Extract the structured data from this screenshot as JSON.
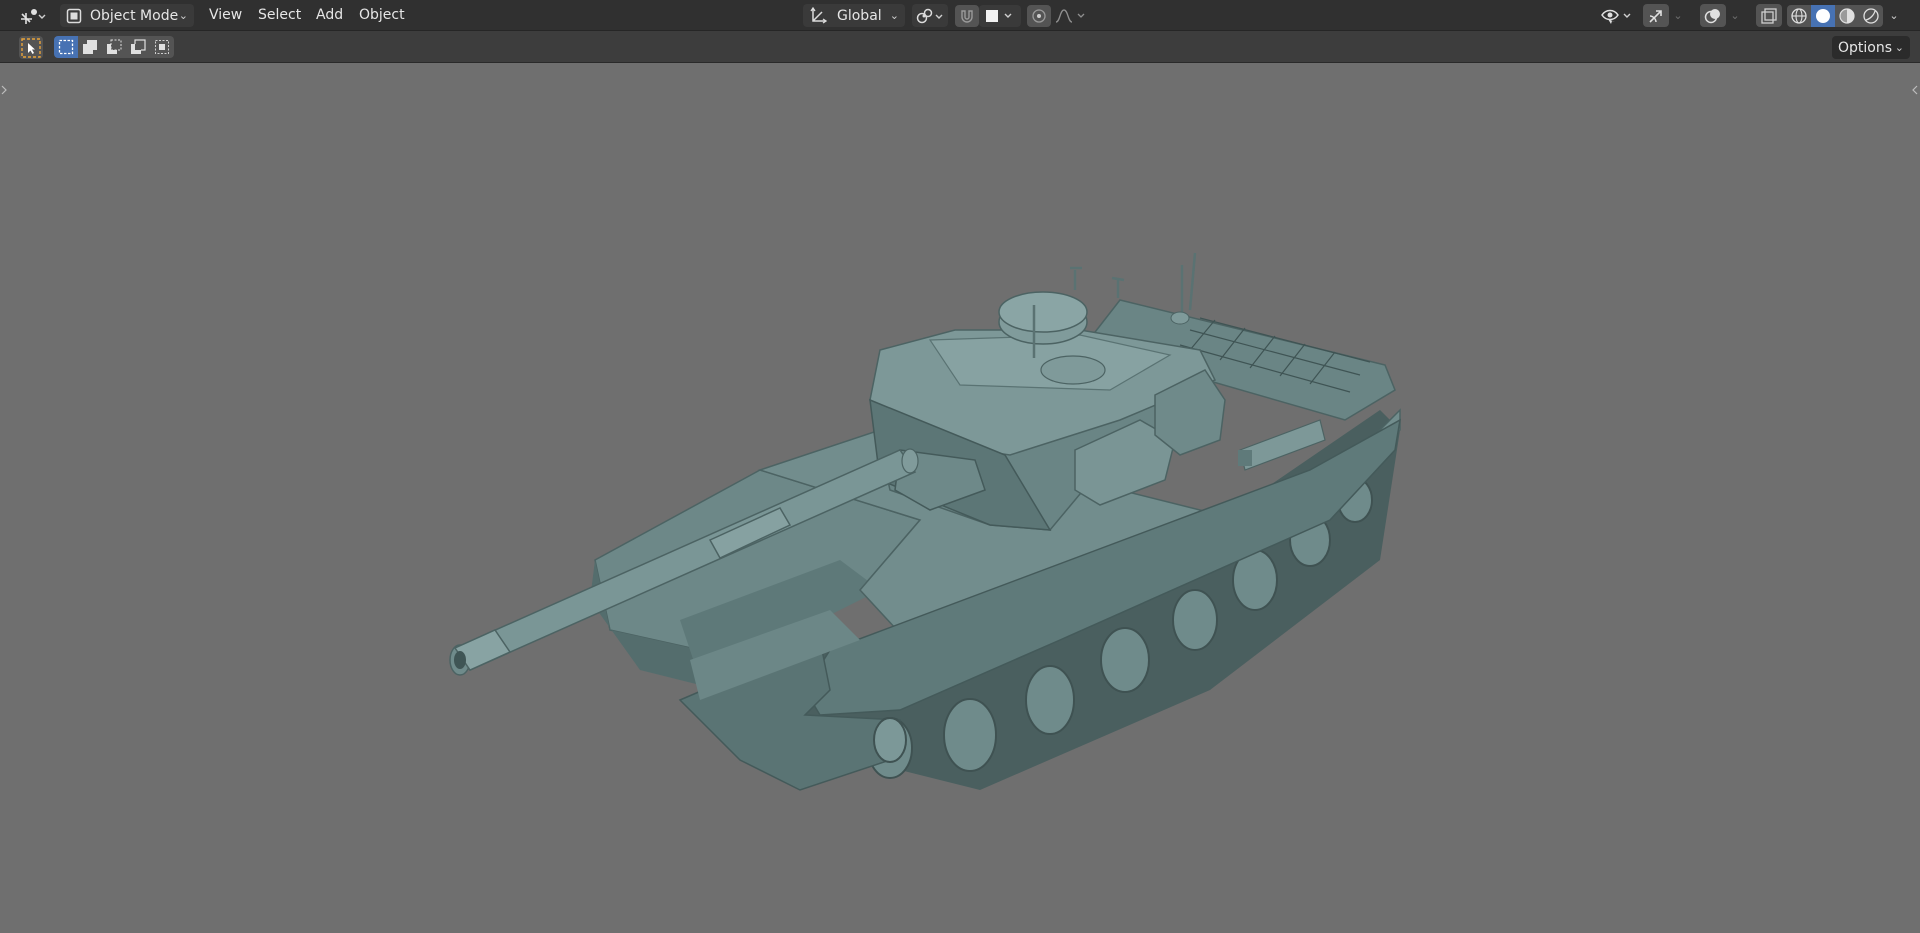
{
  "header": {
    "mode_label": "Object Mode",
    "menus": [
      "View",
      "Select",
      "Add",
      "Object"
    ],
    "transform_orientation": "Global"
  },
  "toolbar": {
    "options_label": "Options"
  },
  "icons": {
    "editor_type": "transform-gizmo-icon",
    "mode": "object-mode-icon",
    "pivot": "pivot-point-icon",
    "snap": "snap-magnet-icon",
    "proportional": "proportional-editing-icon",
    "falloff": "falloff-curve-icon",
    "visibility": "eye-selectable-icon",
    "gizmo": "gizmo-arrow-icon",
    "overlays": "overlay-circles-icon",
    "xray": "xray-toggle-icon",
    "shading_wire": "wireframe-shading-icon",
    "shading_solid": "solid-shading-icon",
    "shading_material": "material-preview-icon",
    "shading_rendered": "rendered-shading-icon",
    "select_tool": "select-cursor-icon",
    "select_new": "select-new-icon",
    "select_extend": "select-extend-icon",
    "select_subtract": "select-subtract-icon",
    "select_invert": "select-invert-icon",
    "select_intersect": "select-intersect-icon"
  },
  "colors": {
    "header_bg": "#303030",
    "viewport_bg": "#6f6f6f",
    "accent_blue": "#4772b3",
    "active_tool_orange": "#e8a33a",
    "model": "#5b7777"
  }
}
